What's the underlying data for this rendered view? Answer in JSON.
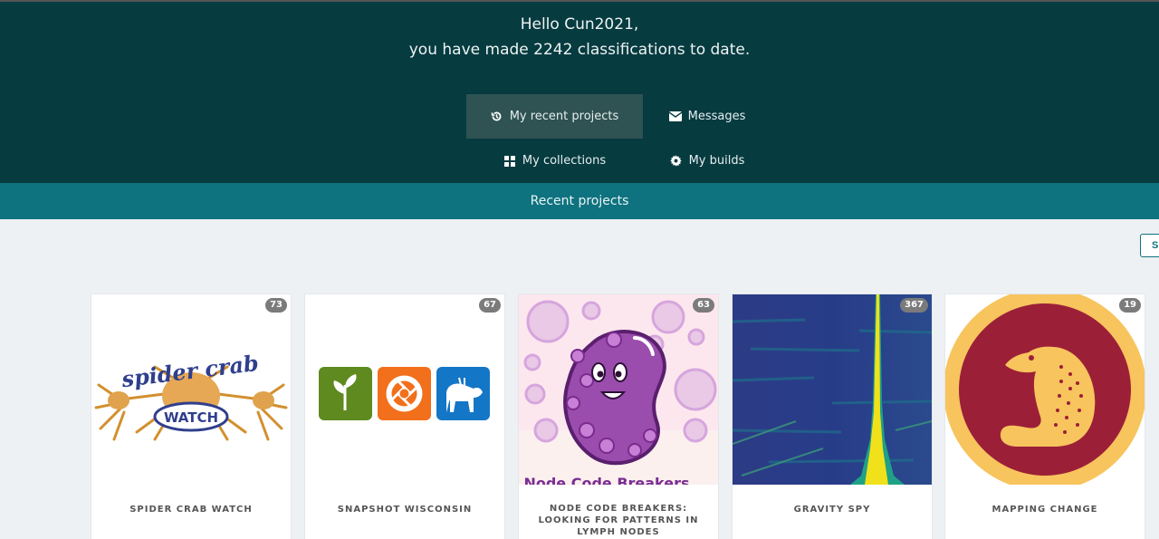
{
  "hero": {
    "greeting": "Hello Cun2021,",
    "summary": "you have made 2242 classifications to date."
  },
  "nav": {
    "recent_projects": {
      "label": "My recent projects",
      "icon": "history-icon"
    },
    "messages": {
      "label": "Messages",
      "icon": "envelope-icon"
    },
    "collections": {
      "label": "My collections",
      "icon": "grid-icon"
    },
    "builds": {
      "label": "My builds",
      "icon": "gear-icon"
    }
  },
  "section": {
    "title": "Recent projects",
    "side_button_label": "S"
  },
  "projects": [
    {
      "name": "SPIDER CRAB WATCH",
      "count": "73",
      "logo_text_1": "spider crab",
      "logo_text_2": "WATCH"
    },
    {
      "name": "SNAPSHOT WISCONSIN",
      "count": "67"
    },
    {
      "name": "NODE CODE BREAKERS: LOOKING FOR PATTERNS IN LYMPH NODES",
      "count": "63",
      "logo_text": "Node Code Breakers"
    },
    {
      "name": "GRAVITY SPY",
      "count": "367"
    },
    {
      "name": "MAPPING CHANGE",
      "count": "19"
    }
  ],
  "colors": {
    "hero_bg": "#063b40",
    "bar_bg": "#0f727f",
    "page_bg": "#eef1f4"
  }
}
